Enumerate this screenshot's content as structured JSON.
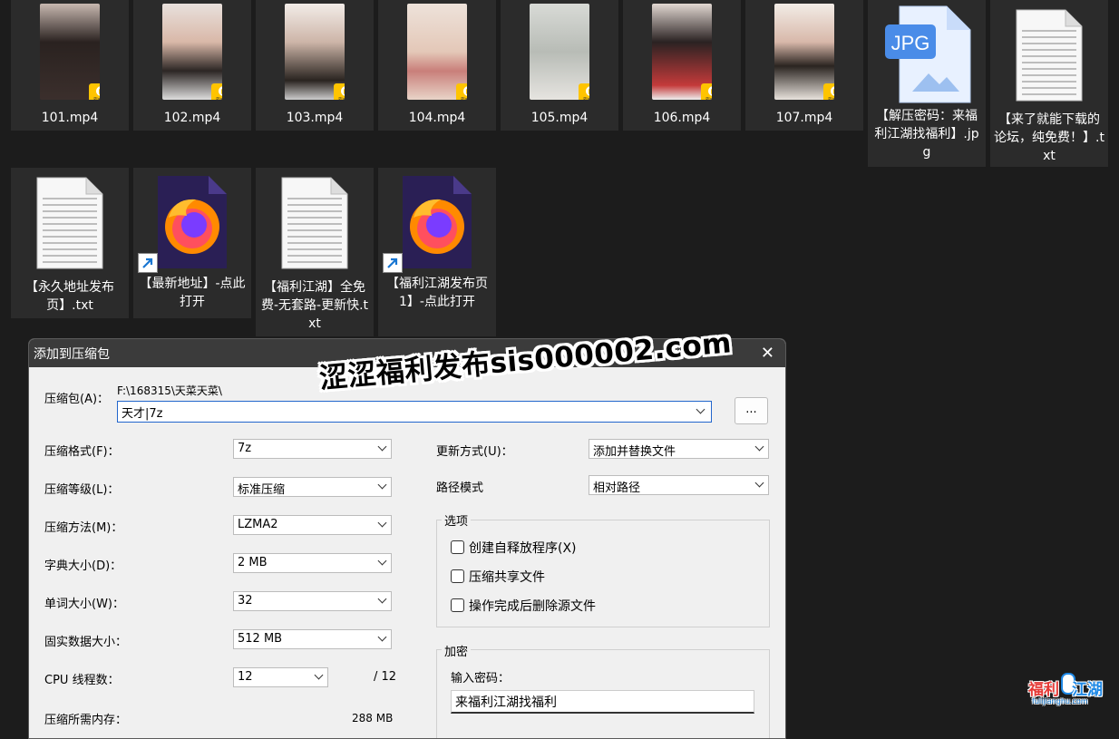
{
  "files_row1": [
    {
      "name": "101.mp4",
      "type": "video"
    },
    {
      "name": "102.mp4",
      "type": "video"
    },
    {
      "name": "103.mp4",
      "type": "video"
    },
    {
      "name": "104.mp4",
      "type": "video"
    },
    {
      "name": "105.mp4",
      "type": "video"
    },
    {
      "name": "106.mp4",
      "type": "video"
    },
    {
      "name": "107.mp4",
      "type": "video"
    },
    {
      "name": "【解压密码：来福利江湖找福利】.jpg",
      "type": "jpg"
    },
    {
      "name": "【来了就能下载的论坛，纯免费！】.txt",
      "type": "txt"
    }
  ],
  "files_row2": [
    {
      "name": "【永久地址发布页】.txt",
      "type": "txt"
    },
    {
      "name": "【最新地址】-点此打开",
      "type": "firefox-shortcut"
    },
    {
      "name": "【福利江湖】全免费-无套路-更新快.txt",
      "type": "txt"
    },
    {
      "name": "【福利江湖发布页1】-点此打开",
      "type": "firefox-shortcut"
    }
  ],
  "icons": {
    "player_badge_text": "Player",
    "jpg_label": "JPG"
  },
  "dialog": {
    "title": "添加到压缩包",
    "archive_label": "压缩包(A)：",
    "archive_path": "F:\\168315\\天菜天菜\\",
    "archive_name": "天才|7z",
    "browse_label": "...",
    "left_rows": [
      {
        "label": "压缩格式(F)：",
        "value": "7z"
      },
      {
        "label": "压缩等级(L)：",
        "value": "标准压缩"
      },
      {
        "label": "压缩方法(M)：",
        "value": "LZMA2"
      },
      {
        "label": "字典大小(D)：",
        "value": "2 MB"
      },
      {
        "label": "单词大小(W)：",
        "value": "32"
      },
      {
        "label": "固实数据大小：",
        "value": "512 MB"
      }
    ],
    "cpu_label": "CPU 线程数：",
    "cpu_value": "12",
    "cpu_max": "/ 12",
    "memory_label": "压缩所需内存：",
    "memory_value": "288 MB",
    "update_label": "更新方式(U)：",
    "update_value": "添加并替换文件",
    "path_label": "路径模式",
    "path_value": "相对路径",
    "options_label": "选项",
    "options": [
      {
        "label": "创建自释放程序(X)",
        "checked": false
      },
      {
        "label": "压缩共享文件",
        "checked": false
      },
      {
        "label": "操作完成后删除源文件",
        "checked": false
      }
    ],
    "encrypt_label": "加密",
    "password_label": "输入密码：",
    "password_value": "来福利江湖找福利"
  },
  "watermark": "涩涩福利发布sis000002.com",
  "logo": {
    "part1": "福利",
    "part2": "江湖",
    "url": "fulijianghu.com"
  },
  "colors": {
    "desktop_bg": "#1c1c1c",
    "tile_bg": "#2b2b2b",
    "badge": "#ffc400",
    "dialog_bg": "#f0f0f0",
    "titlebar": "#3b3b3b"
  }
}
